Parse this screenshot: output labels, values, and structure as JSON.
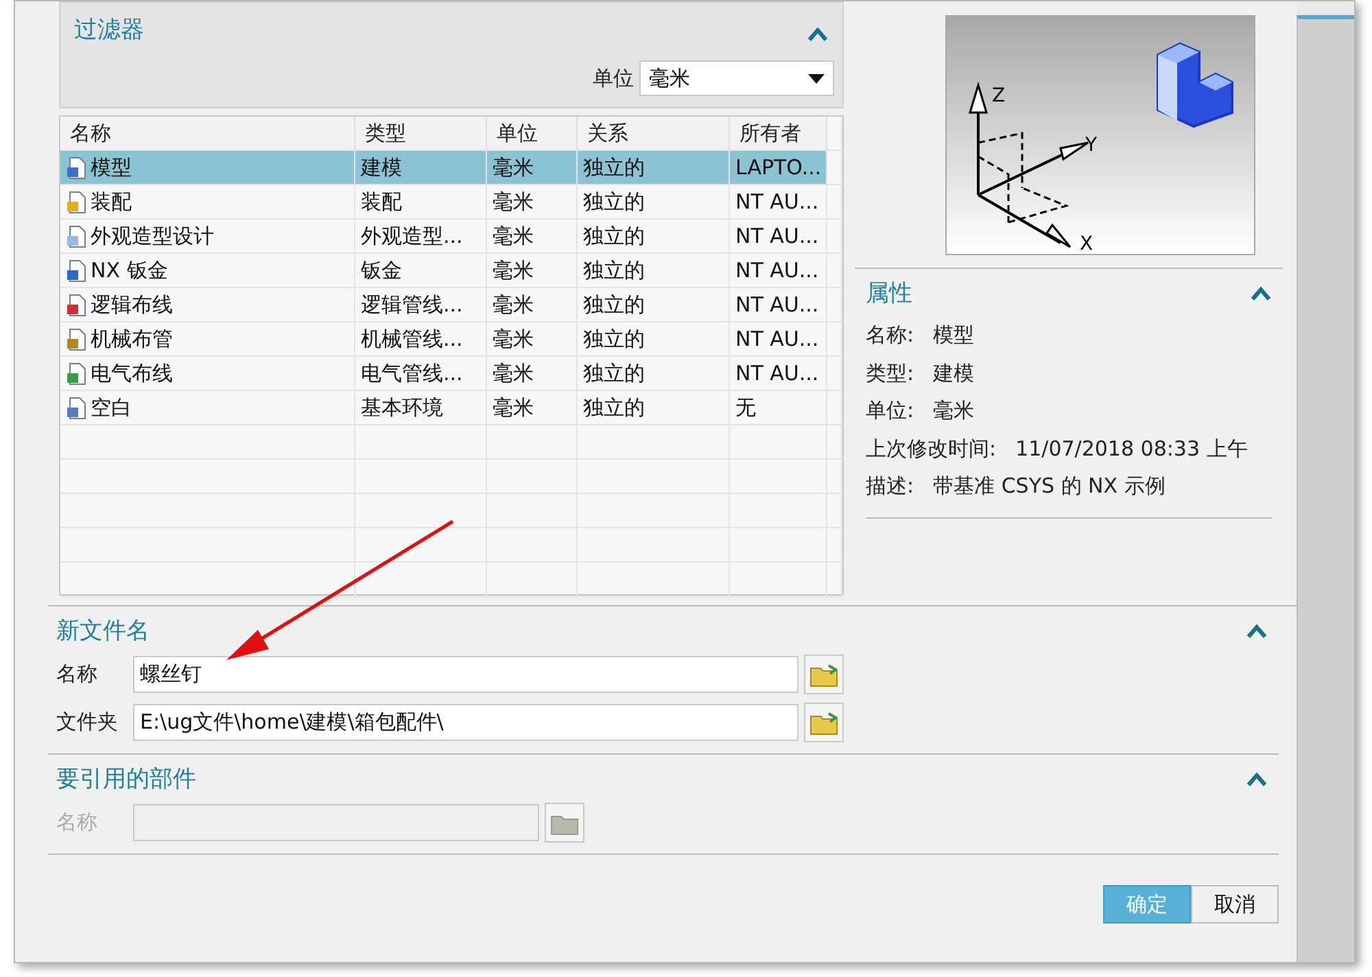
{
  "filter": {
    "title": "过滤器",
    "expanded": true,
    "unit_label": "单位",
    "unit_value": "毫米"
  },
  "table": {
    "columns": [
      "名称",
      "类型",
      "单位",
      "关系",
      "所有者"
    ],
    "rows": [
      {
        "selected": true,
        "color": "#3a6fd0",
        "cells": [
          "模型",
          "建模",
          "毫米",
          "独立的",
          "LAPTO..."
        ]
      },
      {
        "selected": false,
        "color": "#e0b020",
        "cells": [
          "装配",
          "装配",
          "毫米",
          "独立的",
          "NT AU..."
        ]
      },
      {
        "selected": false,
        "color": "#9ab8e0",
        "cells": [
          "外观造型设计",
          "外观造型...",
          "毫米",
          "独立的",
          "NT AU..."
        ]
      },
      {
        "selected": false,
        "color": "#2f66c8",
        "cells": [
          "NX 钣金",
          "钣金",
          "毫米",
          "独立的",
          "NT AU..."
        ]
      },
      {
        "selected": false,
        "color": "#d03030",
        "cells": [
          "逻辑布线",
          "逻辑管线...",
          "毫米",
          "独立的",
          "NT AU..."
        ]
      },
      {
        "selected": false,
        "color": "#b08a20",
        "cells": [
          "机械布管",
          "机械管线...",
          "毫米",
          "独立的",
          "NT AU..."
        ]
      },
      {
        "selected": false,
        "color": "#30a040",
        "cells": [
          "电气布线",
          "电气管线...",
          "毫米",
          "独立的",
          "NT AU..."
        ]
      },
      {
        "selected": false,
        "color": "#5a7ac0",
        "cells": [
          "空白",
          "基本环境",
          "毫米",
          "独立的",
          "无"
        ]
      }
    ]
  },
  "preview": {
    "axis_labels": [
      "Z",
      "Y",
      "X"
    ]
  },
  "properties": {
    "title": "属性",
    "expanded": true,
    "items": [
      {
        "label": "名称:",
        "value": "模型"
      },
      {
        "label": "类型:",
        "value": "建模"
      },
      {
        "label": "单位:",
        "value": "毫米"
      },
      {
        "label": "上次修改时间:",
        "value": "11/07/2018 08:33 上午"
      },
      {
        "label": "描述:",
        "value": "带基准 CSYS 的 NX 示例"
      }
    ]
  },
  "new_file": {
    "title": "新文件名",
    "expanded": true,
    "fields": [
      {
        "label": "名称",
        "value": "螺丝钉",
        "disabled": false
      },
      {
        "label": "文件夹",
        "value": "E:\\ug文件\\home\\建模\\箱包配件\\",
        "disabled": false
      }
    ]
  },
  "referenced_part": {
    "title": "要引用的部件",
    "expanded": true,
    "fields": [
      {
        "label": "名称",
        "disabled": true
      }
    ]
  },
  "buttons": [
    {
      "label": "确定",
      "selected": true
    },
    {
      "label": "取消",
      "selected": false
    }
  ]
}
